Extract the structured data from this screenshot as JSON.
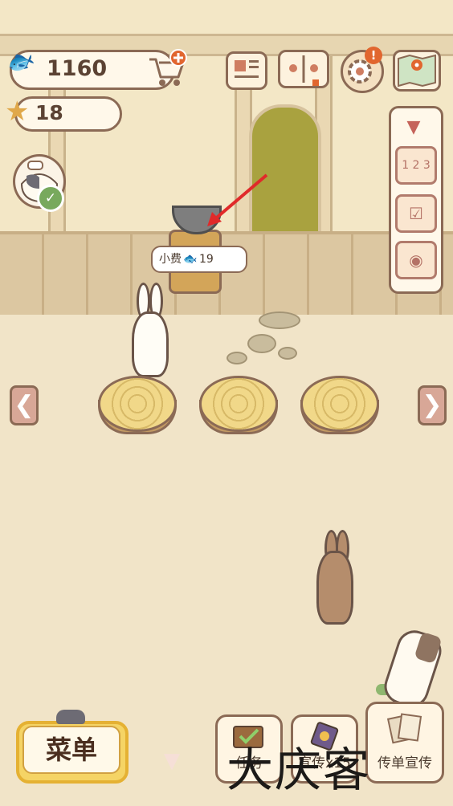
{
  "currency": {
    "fish": "1160",
    "stars": "18"
  },
  "icons": {
    "fish": "fish-icon",
    "star": "star-icon",
    "cart": "cart-add-icon",
    "news": "newspaper-icon",
    "book": "paw-book-icon",
    "gear": "gear-icon",
    "gear_alert": "!",
    "map": "map-icon",
    "check": "✓"
  },
  "side_panel": {
    "collapse": "▼",
    "items": [
      {
        "name": "ranking",
        "glyph": "1 2 3"
      },
      {
        "name": "calendar",
        "glyph": "☑"
      },
      {
        "name": "camera",
        "glyph": "◉"
      }
    ]
  },
  "tip": {
    "label": "小费",
    "amount": "19"
  },
  "nav": {
    "left": "❮",
    "right": "❯"
  },
  "bottom": {
    "menu_label": "菜单",
    "down_tab": "▼",
    "task_label": "任务",
    "promo_label": "宣传x15",
    "flyer_label": "传单宣传"
  },
  "watermark": "大庆客",
  "colors": {
    "accent": "#e1662f",
    "menu": "#f5d465",
    "border": "#8b6a55",
    "arrow": "#e02a2a"
  }
}
